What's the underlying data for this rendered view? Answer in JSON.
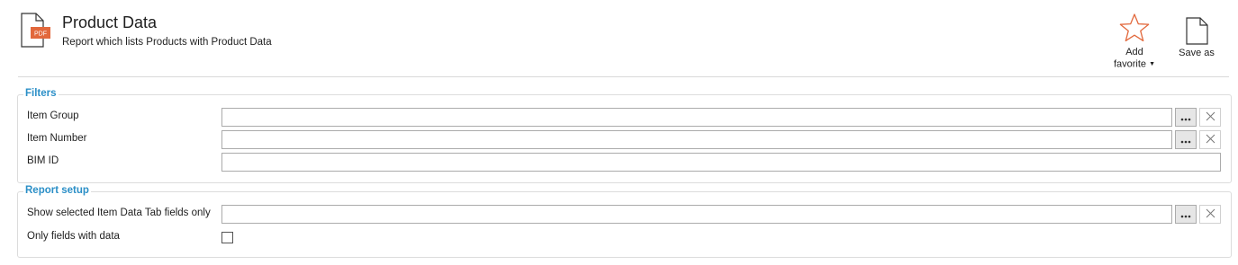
{
  "header": {
    "title": "Product Data",
    "subtitle": "Report which lists Products with Product Data",
    "doc_icon_badge": "PDF",
    "icons": {
      "report": "pdf-document-icon",
      "favorite": "star-icon",
      "save_as": "document-icon"
    },
    "colors": {
      "pdf_badge": "#e2683c",
      "star": "#e2683c"
    }
  },
  "actions": {
    "add_favorite_line1": "Add",
    "add_favorite_line2": "favorite",
    "save_as": "Save as"
  },
  "filters": {
    "title": "Filters",
    "item_group": {
      "label": "Item Group",
      "value": ""
    },
    "item_number": {
      "label": "Item Number",
      "value": ""
    },
    "bim_id": {
      "label": "BIM ID",
      "value": ""
    }
  },
  "report_setup": {
    "title": "Report setup",
    "item_data_tab_fields": {
      "label": "Show selected Item Data Tab fields only",
      "value": ""
    },
    "only_fields_with_data": {
      "label": "Only fields with data",
      "checked": false
    }
  },
  "colors": {
    "section_title": "#2b8fc7"
  }
}
